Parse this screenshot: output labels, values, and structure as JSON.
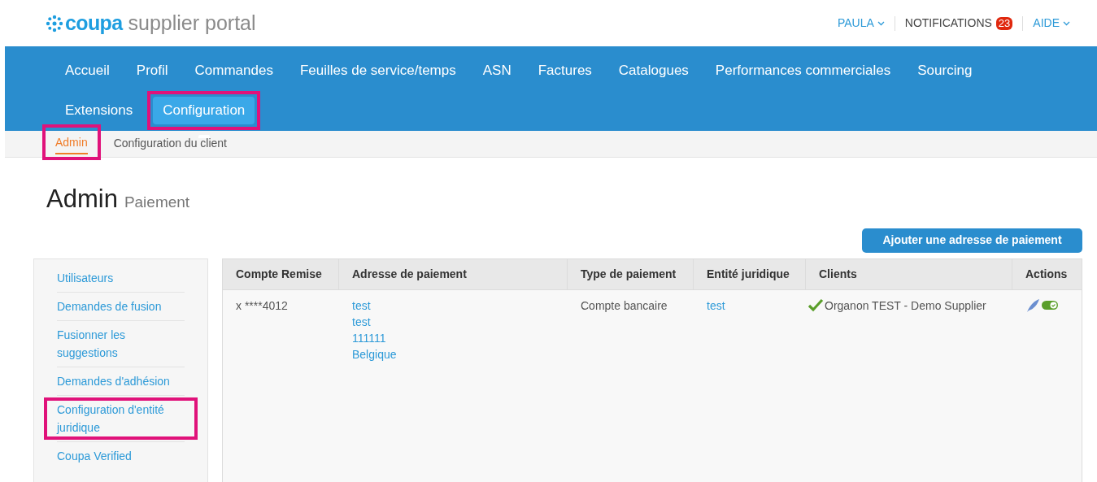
{
  "header": {
    "logo_brand": "coupa",
    "logo_product": "supplier portal",
    "user_menu": "PAULA",
    "notifications": {
      "label": "NOTIFICATIONS",
      "count": "23"
    },
    "help_menu": "AIDE"
  },
  "nav": [
    {
      "label": "Accueil",
      "selected": false,
      "highlighted": false
    },
    {
      "label": "Profil",
      "selected": false,
      "highlighted": false
    },
    {
      "label": "Commandes",
      "selected": false,
      "highlighted": false
    },
    {
      "label": "Feuilles de service/temps",
      "selected": false,
      "highlighted": false
    },
    {
      "label": "ASN",
      "selected": false,
      "highlighted": false
    },
    {
      "label": "Factures",
      "selected": false,
      "highlighted": false
    },
    {
      "label": "Catalogues",
      "selected": false,
      "highlighted": false
    },
    {
      "label": "Performances commerciales",
      "selected": false,
      "highlighted": false
    },
    {
      "label": "Sourcing",
      "selected": false,
      "highlighted": false
    },
    {
      "label": "Extensions",
      "selected": false,
      "highlighted": false
    },
    {
      "label": "Configuration",
      "selected": true,
      "highlighted": true
    }
  ],
  "subnav": [
    {
      "label": "Admin",
      "selected": true,
      "highlighted": true
    },
    {
      "label": "Configuration du client",
      "selected": false,
      "highlighted": false
    }
  ],
  "page_title": "Admin",
  "page_subtitle": "Paiement",
  "add_button": "Ajouter une adresse de paiement",
  "sidebar": {
    "items": [
      {
        "label": "Utilisateurs",
        "highlighted": false
      },
      {
        "label": "Demandes de fusion",
        "highlighted": false
      },
      {
        "label": "Fusionner les suggestions",
        "highlighted": false
      },
      {
        "label": "Demandes d'adhésion",
        "highlighted": false
      },
      {
        "label": "Configuration d'entité juridique",
        "highlighted": true
      },
      {
        "label": "Coupa Verified",
        "highlighted": false
      }
    ]
  },
  "table": {
    "columns": [
      "Compte Remise",
      "Adresse de paiement",
      "Type de paiement",
      "Entité juridique",
      "Clients",
      "Actions"
    ],
    "rows": [
      {
        "account": "x ****4012",
        "address": [
          "test",
          "test",
          "111111",
          "Belgique"
        ],
        "payment_type": "Compte bancaire",
        "legal_entity": "test",
        "client": "Organon TEST - Demo Supplier",
        "client_verified": true,
        "enabled": true
      }
    ]
  }
}
